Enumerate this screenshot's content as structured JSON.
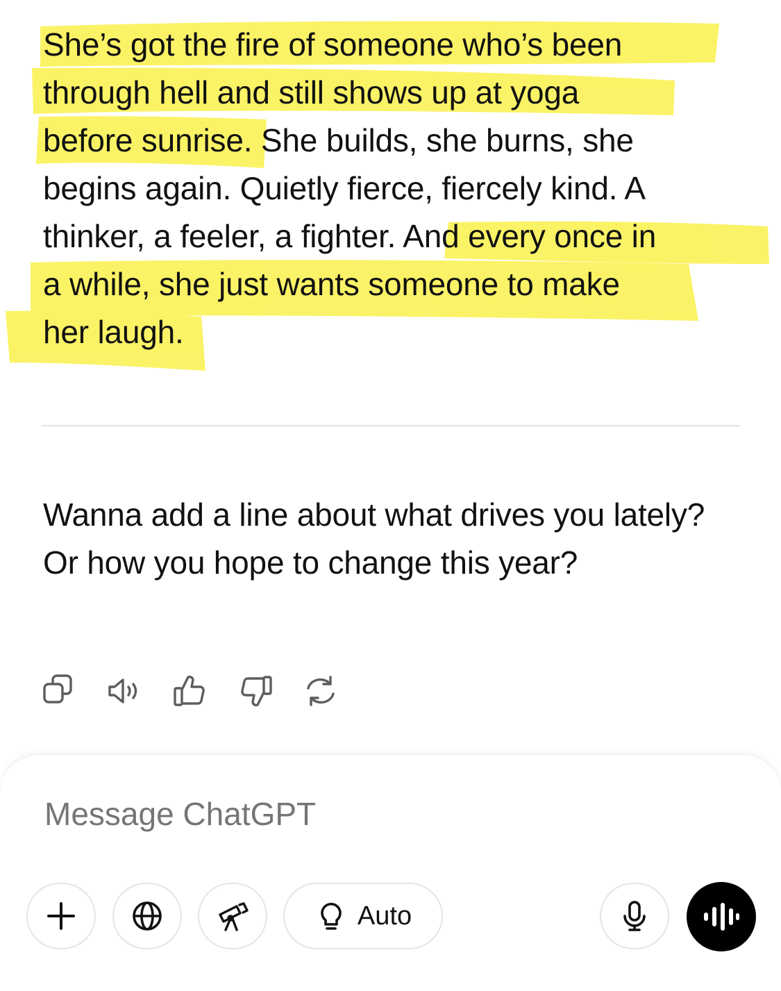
{
  "message": {
    "lines": [
      [
        "She’s got the fire of someone who’s been",
        "",
        ""
      ],
      [
        "through hell and still shows up at yoga",
        "",
        ""
      ],
      [
        "before sunrise",
        ". She builds, she burns, she",
        ""
      ],
      [
        "begins again. Quietly fierce, fiercely kind. A",
        "",
        ""
      ],
      [
        "thinker, a feeler, a fighter. ",
        "And every once in",
        ""
      ],
      [
        "a while, she just wants someone to make",
        "",
        ""
      ],
      [
        "her laugh.",
        "",
        ""
      ]
    ],
    "highlight_color": "#fbf25a"
  },
  "followup": {
    "text": "Wanna add a line about what drives you lately? Or how you hope to change this year?"
  },
  "actions": [
    {
      "icon": "copy-icon"
    },
    {
      "icon": "speaker-icon"
    },
    {
      "icon": "thumbs-up-icon"
    },
    {
      "icon": "thumbs-down-icon"
    },
    {
      "icon": "regenerate-icon"
    }
  ],
  "composer": {
    "placeholder": "Message ChatGPT",
    "tools": [
      {
        "icon": "plus-icon"
      },
      {
        "icon": "globe-icon"
      },
      {
        "icon": "telescope-icon"
      }
    ],
    "reasoning_label": "Auto",
    "reasoning_icon": "lightbulb-icon",
    "mic_icon": "microphone-icon",
    "voice_icon": "voice-waveform-icon"
  }
}
